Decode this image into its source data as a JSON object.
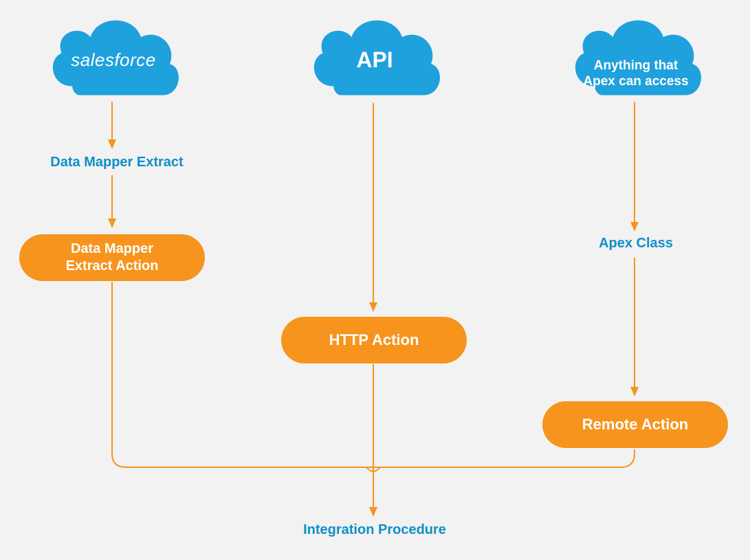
{
  "clouds": {
    "salesforce": "salesforce",
    "api": "API",
    "apex": "Anything that\nApex can access"
  },
  "labels": {
    "data_mapper_extract": "Data Mapper Extract",
    "apex_class": "Apex Class",
    "integration_procedure": "Integration Procedure"
  },
  "actions": {
    "data_mapper_extract_action": "Data Mapper\nExtract Action",
    "http_action": "HTTP Action",
    "remote_action": "Remote Action"
  },
  "colors": {
    "cloud_blue": "#1ea1dc",
    "label_blue": "#0f8ec7",
    "pill_orange": "#f6941d",
    "arrow_orange": "#f6941d"
  }
}
